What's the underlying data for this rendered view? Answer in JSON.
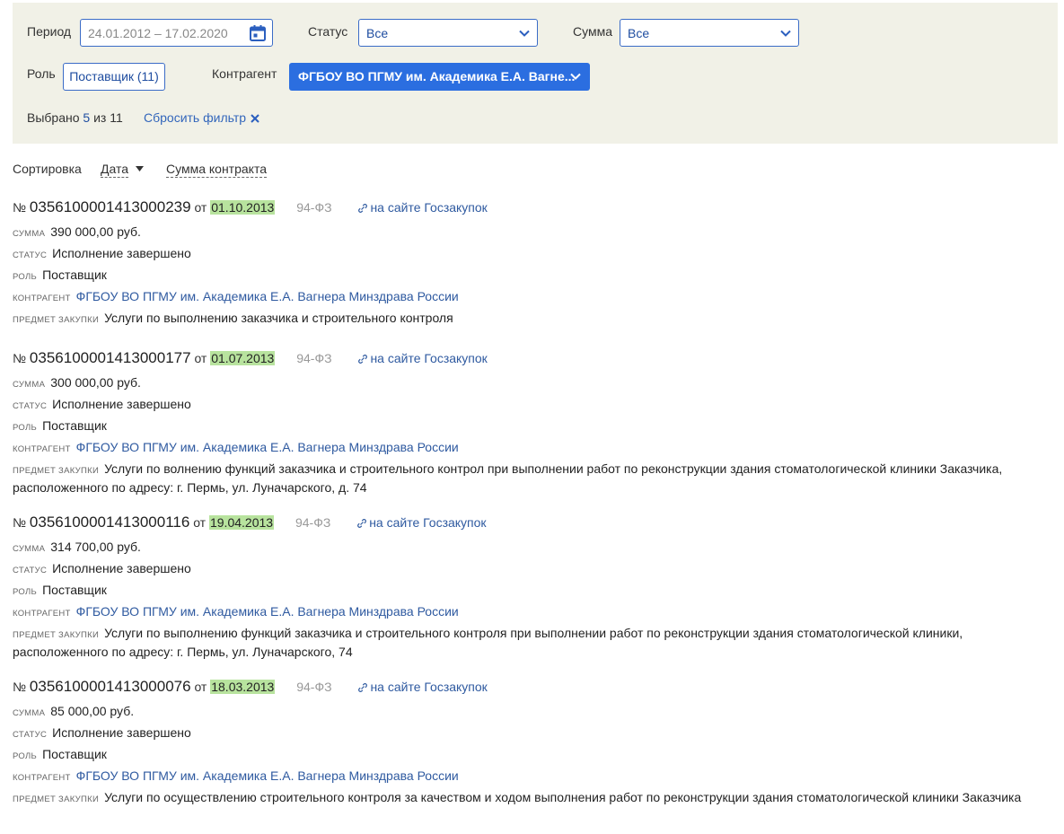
{
  "filters": {
    "period_label": "Период",
    "period_value": "24.01.2012 – 17.02.2020",
    "status_label": "Статус",
    "status_value": "Все",
    "sum_label": "Сумма",
    "sum_value": "Все",
    "role_label": "Роль",
    "role_value": "Поставщик (11)",
    "kontragent_label": "Контрагент",
    "kontragent_value": "ФГБОУ ВО ПГМУ им. Академика Е.А. Вагне...",
    "selected_prefix": "Выбрано",
    "selected_count": "5",
    "selected_suffix": "из 11",
    "reset_label": "Сбросить фильтр"
  },
  "sort": {
    "label": "Сортировка",
    "date": "Дата",
    "sum": "Сумма контракта"
  },
  "labels": {
    "no": "№",
    "ot": "от",
    "sum": "сумма",
    "status": "статус",
    "role": "роль",
    "kontragent": "контрагент",
    "subject": "предмет закупки"
  },
  "contracts": [
    {
      "number": "0356100001413000239",
      "date": "01.10.2013",
      "law": "94-ФЗ",
      "link": "на сайте Госзакупок",
      "sum": "390 000,00 руб.",
      "status": "Исполнение завершено",
      "role": "Поставщик",
      "kontragent": "ФГБОУ ВО ПГМУ им. Академика Е.А. Вагнера Минздрава России",
      "subject": "Услуги по выполнению заказчика и строительного контроля"
    },
    {
      "number": "0356100001413000177",
      "date": "01.07.2013",
      "law": "94-ФЗ",
      "link": "на сайте Госзакупок",
      "sum": "300 000,00 руб.",
      "status": "Исполнение завершено",
      "role": "Поставщик",
      "kontragent": "ФГБОУ ВО ПГМУ им. Академика Е.А. Вагнера Минздрава России",
      "subject": "Услуги по волнению функций заказчика и строительного контрол при выполнении работ по реконструкции здания стоматологической клиники Заказчика, расположенного по адресу: г. Пермь, ул. Луначарского, д. 74"
    },
    {
      "number": "0356100001413000116",
      "date": "19.04.2013",
      "law": "94-ФЗ",
      "link": "на сайте Госзакупок",
      "sum": "314 700,00 руб.",
      "status": "Исполнение завершено",
      "role": "Поставщик",
      "kontragent": "ФГБОУ ВО ПГМУ им. Академика Е.А. Вагнера Минздрава России",
      "subject": "Услуги по выполнению функций заказчика и строительного контроля при выполнении работ по реконструкции здания стоматологической клиники, расположенного по адресу: г. Пермь, ул. Луначарского, 74"
    },
    {
      "number": "0356100001413000076",
      "date": "18.03.2013",
      "law": "94-ФЗ",
      "link": "на сайте Госзакупок",
      "sum": "85 000,00 руб.",
      "status": "Исполнение завершено",
      "role": "Поставщик",
      "kontragent": "ФГБОУ ВО ПГМУ им. Академика Е.А. Вагнера Минздрава России",
      "subject": "Услуги по осуществлению строительного контроля за качеством и ходом выполнения работ по реконструкции здания стоматологической клиники Заказчика"
    }
  ]
}
